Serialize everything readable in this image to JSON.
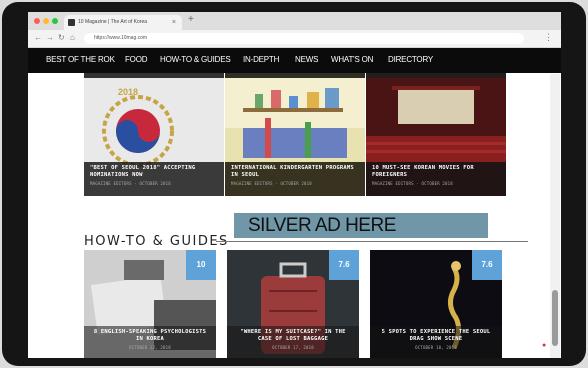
{
  "browser": {
    "tab_title": "10 Magazine | The Art of Korea",
    "tab_close": "×",
    "new_tab": "+",
    "url": "https://www.10mag.com",
    "back": "←",
    "forward": "→",
    "reload": "↻",
    "home": "⌂",
    "menu": "⋮",
    "colors": {
      "close": "#fe5f57",
      "minimize": "#febc2e",
      "maximize": "#28c840"
    }
  },
  "nav": {
    "items": [
      "BEST OF THE ROK",
      "FOOD",
      "HOW-TO & GUIDES",
      "IN-DEPTH",
      "NEWS",
      "WHAT'S ON",
      "DIRECTORY"
    ]
  },
  "top_cards": [
    {
      "title": "\"BEST OF SEOUL 2018\" ACCEPTING NOMINATIONS NOW",
      "meta": "MAGAZINE EDITORS · OCTOBER 2018",
      "badge_year": "2018"
    },
    {
      "title": "INTERNATIONAL KINDERGARTEN PROGRAMS IN SEOUL",
      "meta": "MAGAZINE EDITORS · OCTOBER 2018"
    },
    {
      "title": "10 MUST-SEE KOREAN MOVIES FOR FOREIGNERS",
      "meta": "MAGAZINE EDITORS · OCTOBER 2018"
    }
  ],
  "ad": {
    "label": "SILVER AD HERE",
    "color": "#6f97a7"
  },
  "section": {
    "title": "HOW-TO & GUIDES"
  },
  "guide_cards": [
    {
      "title": "8 ENGLISH-SPEAKING PSYCHOLOGISTS IN KOREA",
      "meta": "OCTOBER 22, 2018",
      "score": "10"
    },
    {
      "title": "\"WHERE IS MY SUITCASE?\" IN THE CASE OF LOST BAGGAGE",
      "meta": "OCTOBER 17, 2018",
      "score": "7.6"
    },
    {
      "title": "5 SPOTS TO EXPERIENCE THE SEOUL DRAG SHOW SCENE",
      "meta": "OCTOBER 10, 2018",
      "score": "7.6"
    }
  ],
  "accent_color": "#5ea2d8"
}
